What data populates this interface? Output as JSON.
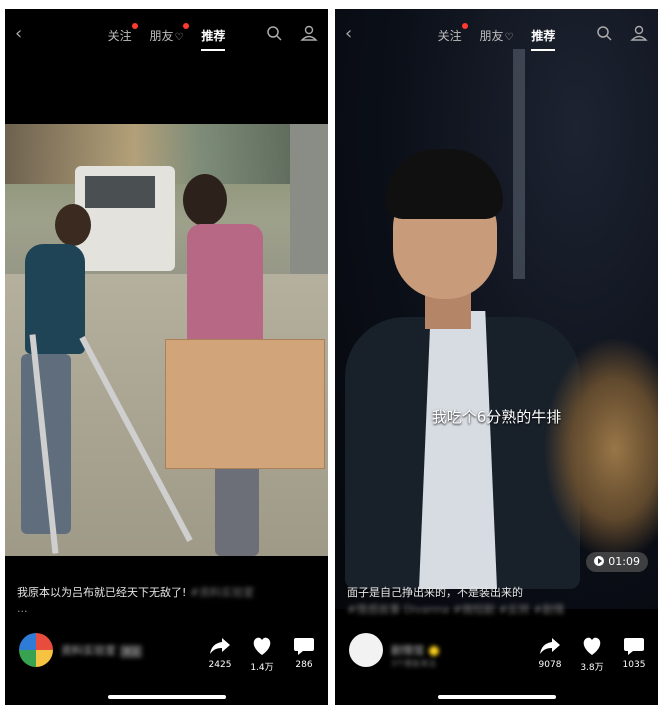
{
  "screens": [
    {
      "top_tabs": {
        "follow": "关注",
        "friends": "朋友",
        "recommend": "推荐"
      },
      "caption": "我原本以为吕布就已经天下无敌了!",
      "caption_hidden": "#资料实验室",
      "caption_more": "...",
      "author_name": "资料实验室",
      "author_tag": "关注",
      "shares": "2425",
      "likes": "1.4万",
      "comments": "286"
    },
    {
      "top_tabs": {
        "follow": "关注",
        "friends": "朋友",
        "recommend": "推荐"
      },
      "subtitle": "我吃个6分熟的牛排",
      "duration": "01:09",
      "caption": "面子是自己挣出来的，不是装出来的",
      "caption_hidden": "#情感故事 Divanna #微短剧 #反转 #剧情",
      "author_name": "剧情馆",
      "author_sub": "3个朋友关注",
      "shares": "9078",
      "likes": "3.8万",
      "comments": "1035"
    }
  ],
  "icons": {
    "back": "chevron-left-icon",
    "search": "search-icon",
    "profile": "user-icon",
    "share": "share-arrow-icon",
    "like": "heart-icon",
    "comment": "comment-icon"
  },
  "colors": {
    "badge_dot": "#ff3b30",
    "background": "#000000",
    "verified": "#ffd21e"
  }
}
